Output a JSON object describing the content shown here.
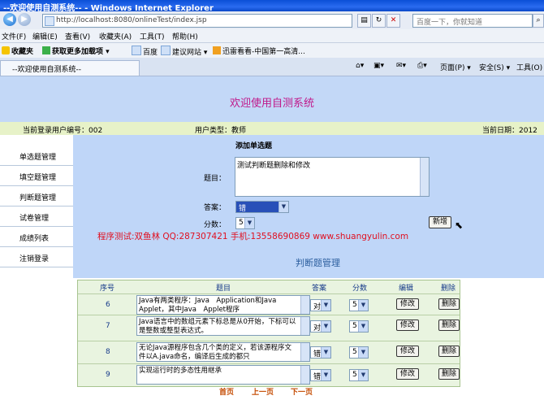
{
  "window": {
    "title": "--欢迎使用自测系统-- - Windows Internet Explorer"
  },
  "address": {
    "url": "http://localhost:8080/onlineTest/index.jsp",
    "search_placeholder": "百度一下，你就知道"
  },
  "menu": [
    "文件(F)",
    "编辑(E)",
    "查看(V)",
    "收藏夹(A)",
    "工具(T)",
    "帮助(H)"
  ],
  "favorites": {
    "label": "收藏夹",
    "items": [
      "获取更多加载项 ▾",
      "百度",
      "建议网站 ▾",
      "迅雷看看-中国第一高清..."
    ]
  },
  "tab": {
    "title": "--欢迎使用自测系统--",
    "right_items": [
      "页面(P) ▾",
      "安全(S) ▾",
      "工具(O) ▾"
    ]
  },
  "header": {
    "title": "欢迎使用自测系统"
  },
  "userbar": {
    "user_id": "当前登录用户编号：002",
    "user_type": "用户类型：教师",
    "date": "当前日期：2012"
  },
  "sidebar": [
    "单选题管理",
    "填空题管理",
    "判断题管理",
    "试卷管理",
    "成绩列表",
    "注销登录"
  ],
  "form": {
    "heading": "添加单选题",
    "question_label": "题目：",
    "question_value": "测试判断题删除和修改",
    "answer_label": "答案：",
    "answer_value": "错",
    "score_label": "分数：",
    "score_value": "5",
    "add_button": "新增"
  },
  "watermark": "程序测试:双鱼林 QQ:287307421 手机:13558690869 www.shuangyulin.com",
  "management_title": "判断题管理",
  "table": {
    "headers": [
      "序号",
      "题目",
      "答案",
      "分数",
      "编辑",
      "删除"
    ],
    "rows": [
      {
        "id": "6",
        "question": "Java有两类程序：Java　Application和Java　Applet，其中Java　Applet程序",
        "answer": "对",
        "score": "5",
        "edit": "修改",
        "delete": "删除"
      },
      {
        "id": "7",
        "question": "Java语言中的数组元素下标总是从0开始，下标可以是整数或整型表达式。",
        "answer": "对",
        "score": "5",
        "edit": "修改",
        "delete": "删除"
      },
      {
        "id": "8",
        "question": "无论Java源程序包含几个类的定义，若该源程序文件以A.java命名，编译后生成的都只",
        "answer": "错",
        "score": "5",
        "edit": "修改",
        "delete": "删除"
      },
      {
        "id": "9",
        "question": "实现运行时的多态性用继承",
        "answer": "错",
        "score": "5",
        "edit": "修改",
        "delete": "删除"
      }
    ]
  },
  "pager": [
    "首页",
    "上一页",
    "下一页"
  ]
}
